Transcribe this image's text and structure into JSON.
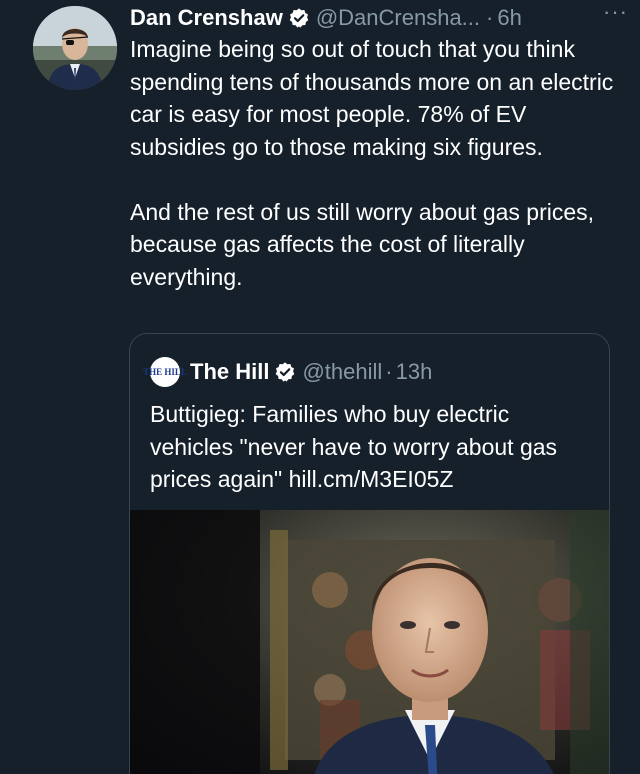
{
  "tweet": {
    "author_name": "Dan Crenshaw",
    "handle": "@DanCrensha...",
    "separator": "·",
    "time": "6h",
    "more_label": "···",
    "paragraphs": [
      "Imagine being so out of touch that you think spending tens of thousands more on an electric car is easy for most people. 78% of EV subsidies go to those making six figures.",
      "And the rest of us still worry about gas prices, because gas affects the cost of literally everything."
    ]
  },
  "quote": {
    "logo_text": "THE HILL",
    "author_name": "The Hill",
    "handle": "@thehill",
    "separator": "·",
    "time": "13h",
    "text": "Buttigieg: Families who buy electric vehicles \"never have to worry about gas prices again\" hill.cm/M3EI05Z"
  },
  "icons": {
    "verified": "verified-badge-icon",
    "more": "more-options-icon",
    "avatar": "avatar-photo",
    "logo": "the-hill-logo"
  },
  "colors": {
    "background": "#15202b",
    "text": "#ffffff",
    "secondary_text": "#8899a6",
    "border": "#38444d",
    "verified": "#ffffff"
  }
}
